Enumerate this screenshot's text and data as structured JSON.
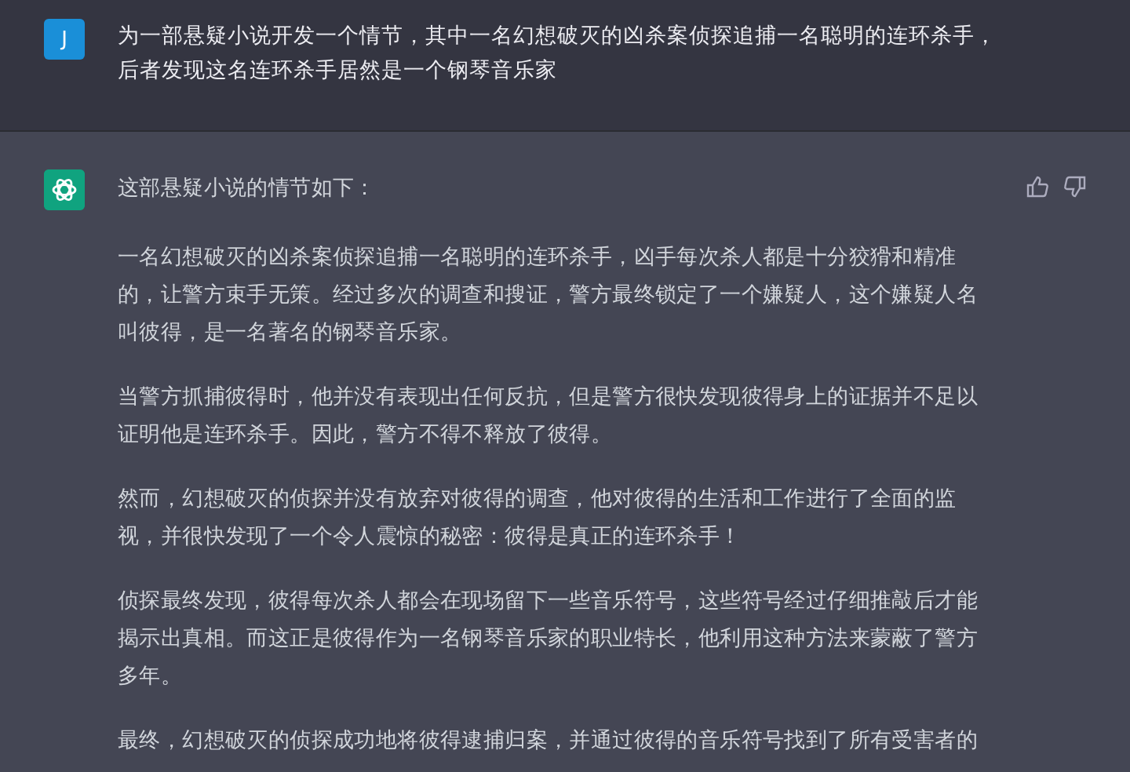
{
  "prompt": {
    "avatar_letter": "J",
    "text": "为一部悬疑小说开发一个情节，其中一名幻想破灭的凶杀案侦探追捕一名聪明的连环杀手，后者发现这名连环杀手居然是一个钢琴音乐家"
  },
  "reply": {
    "heading": "这部悬疑小说的情节如下：",
    "paragraphs": [
      "一名幻想破灭的凶杀案侦探追捕一名聪明的连环杀手，凶手每次杀人都是十分狡猾和精准的，让警方束手无策。经过多次的调查和搜证，警方最终锁定了一个嫌疑人，这个嫌疑人名叫彼得，是一名著名的钢琴音乐家。",
      "当警方抓捕彼得时，他并没有表现出任何反抗，但是警方很快发现彼得身上的证据并不足以证明他是连环杀手。因此，警方不得不释放了彼得。",
      "然而，幻想破灭的侦探并没有放弃对彼得的调查，他对彼得的生活和工作进行了全面的监视，并很快发现了一个令人震惊的秘密：彼得是真正的连环杀手！",
      "侦探最终发现，彼得每次杀人都会在现场留下一些音乐符号，这些符号经过仔细推敲后才能揭示出真相。而这正是彼得作为一名钢琴音乐家的职业特长，他利用这种方法来蒙蔽了警方多年。",
      "最终，幻想破灭的侦探成功地将彼得逮捕归案，并通过彼得的音乐符号找到了所有受害者的"
    ]
  }
}
